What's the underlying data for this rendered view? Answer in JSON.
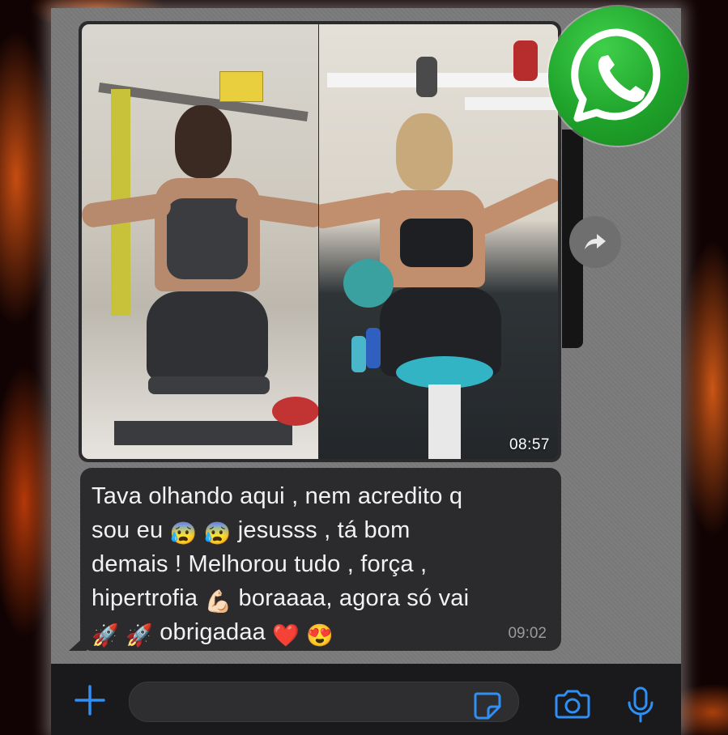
{
  "conversation": {
    "image_message": {
      "time": "08:57"
    },
    "text_message": {
      "lines": [
        "Tava olhando aqui , nem acredito q",
        "sou eu",
        "jesusss , tá bom",
        "demais ! Melhorou tudo , força ,",
        "hipertrofia",
        "boraaaa, agora só vai",
        "obrigadaa"
      ],
      "time": "09:02"
    }
  },
  "icons": {
    "forward": "forward-arrow-icon",
    "plus": "plus-icon",
    "sticker": "sticker-icon",
    "camera": "camera-icon",
    "mic": "microphone-icon",
    "logo": "whatsapp-logo"
  },
  "colors": {
    "bubble": "#2b2b2d",
    "accent_blue": "#2f8ff5",
    "whatsapp_green": "#25a533"
  }
}
